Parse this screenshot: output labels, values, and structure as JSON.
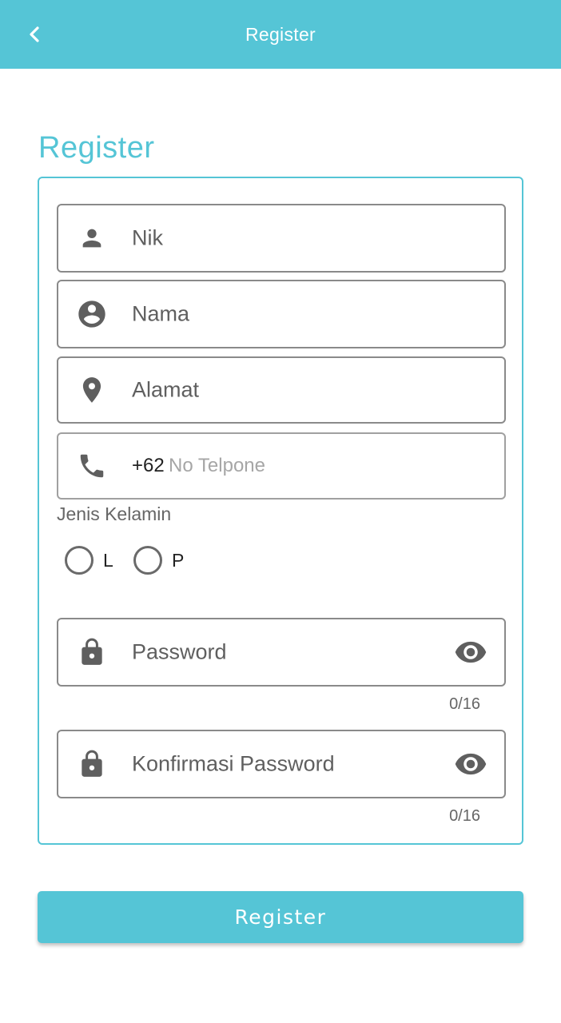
{
  "appbar": {
    "title": "Register",
    "back_icon": "chevron-left-icon"
  },
  "heading": "Register",
  "form": {
    "nik": {
      "placeholder": "Nik",
      "icon": "person-icon"
    },
    "nama": {
      "placeholder": "Nama",
      "icon": "account-circle-icon"
    },
    "alamat": {
      "placeholder": "Alamat",
      "icon": "location-pin-icon"
    },
    "phone": {
      "prefix": "+62",
      "placeholder": "No Telpone",
      "icon": "phone-icon"
    },
    "gender": {
      "label": "Jenis Kelamin",
      "options": [
        "L",
        "P"
      ],
      "selected": null
    },
    "password": {
      "placeholder": "Password",
      "counter": "0/16",
      "icon": "lock-icon",
      "toggle_icon": "eye-icon"
    },
    "confirm_password": {
      "placeholder": "Konfirmasi Password",
      "counter": "0/16",
      "icon": "lock-icon",
      "toggle_icon": "eye-icon"
    }
  },
  "submit_label": "Register",
  "colors": {
    "accent": "#55c5d6",
    "field_border": "#8a8a8a",
    "icon": "#5f5f5f"
  }
}
